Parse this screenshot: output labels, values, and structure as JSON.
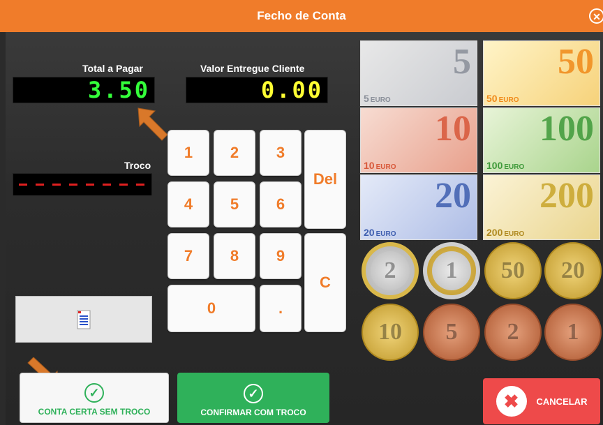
{
  "window": {
    "title": "Fecho de Conta",
    "close_symbol": "✕"
  },
  "labels": {
    "total": "Total a Pagar",
    "entregue": "Valor Entregue Cliente",
    "troco": "Troco"
  },
  "values": {
    "total": "3.50",
    "entregue": "0.00"
  },
  "keypad": {
    "k1": "1",
    "k2": "2",
    "k3": "3",
    "k4": "4",
    "k5": "5",
    "k6": "6",
    "k7": "7",
    "k8": "8",
    "k9": "9",
    "k0": "0",
    "dot": ".",
    "del": "Del",
    "clear": "C"
  },
  "notes": {
    "n5": {
      "value": "5",
      "text": "EURO",
      "color": "#8a8f99"
    },
    "n10": {
      "value": "10",
      "text": "EURO",
      "color": "#d8583a"
    },
    "n20": {
      "value": "20",
      "text": "EURO",
      "color": "#3f5fb0"
    },
    "n50": {
      "value": "50",
      "text": "EURO",
      "color": "#f08a1a"
    },
    "n100": {
      "value": "100",
      "text": "EURO",
      "color": "#3f9a3a"
    },
    "n200": {
      "value": "200",
      "text": "EURO",
      "color": "#c8a52a"
    }
  },
  "coins": {
    "c2e": "2",
    "c1e": "1",
    "c50": "50",
    "c20": "20",
    "c10": "10",
    "c5": "5",
    "c2c": "2",
    "c1c": "1"
  },
  "buttons": {
    "conta_certa": "CONTA CERTA SEM TROCO",
    "confirmar": "CONFIRMAR COM TROCO",
    "cancelar": "CANCELAR"
  },
  "colors": {
    "accent": "#f07c2a",
    "green_display": "#34ff3a",
    "yellow_display": "#ffff33",
    "confirm_green": "#2fb15a",
    "cancel_red": "#ee4a4a"
  },
  "icons": {
    "check": "check-circle-icon",
    "cancel": "x-circle-icon",
    "doc": "document-icon",
    "arrow": "pointer-arrow-icon"
  }
}
